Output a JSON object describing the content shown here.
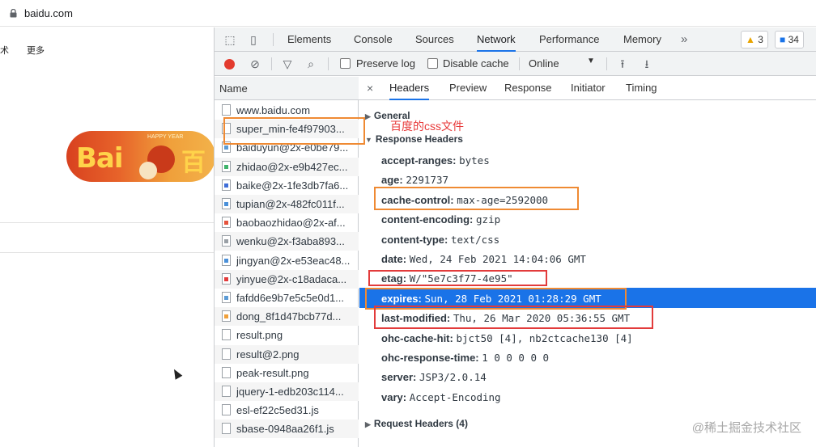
{
  "browser": {
    "url": "baidu.com"
  },
  "page": {
    "nav_left": "术",
    "nav_more": "更多",
    "doodle": {
      "logo_bai": "Bai",
      "logo_du": "百",
      "badge": "HAPPY  YEAR"
    }
  },
  "devtools": {
    "tabs": [
      "Elements",
      "Console",
      "Sources",
      "Network",
      "Performance",
      "Memory"
    ],
    "active_tab": "Network",
    "more_tabs": "»",
    "warnings": "3",
    "messages": "34",
    "toolbar": {
      "preserve_log": "Preserve log",
      "disable_cache": "Disable cache",
      "throttle": "Online",
      "caret": "▼"
    },
    "name_header": "Name",
    "requests": [
      {
        "name": "www.baidu.com",
        "mark": ""
      },
      {
        "name": "super_min-fe4f97903...",
        "mark": ""
      },
      {
        "name": "baiduyun@2x-e0be79...",
        "mark": "#5b9bd5"
      },
      {
        "name": "zhidao@2x-e9b427ec...",
        "mark": "#3fb36b"
      },
      {
        "name": "baike@2x-1fe3db7fa6...",
        "mark": "#3f6ed8"
      },
      {
        "name": "tupian@2x-482fc011f...",
        "mark": "#4a90d9"
      },
      {
        "name": "baobaozhidao@2x-af...",
        "mark": "#e5533d"
      },
      {
        "name": "wenku@2x-f3aba893...",
        "mark": "#9aa0a6"
      },
      {
        "name": "jingyan@2x-e53eac48...",
        "mark": "#4a90d9"
      },
      {
        "name": "yinyue@2x-c18adaca...",
        "mark": "#e23b3b"
      },
      {
        "name": "fafdd6e9b7e5c5e0d1...",
        "mark": "#5b9bd5"
      },
      {
        "name": "dong_8f1d47bcb77d...",
        "mark": "#f0a03b"
      },
      {
        "name": "result.png",
        "mark": ""
      },
      {
        "name": "result@2.png",
        "mark": ""
      },
      {
        "name": "peak-result.png",
        "mark": ""
      },
      {
        "name": "jquery-1-edb203c114...",
        "mark": ""
      },
      {
        "name": "esl-ef22c5ed31.js",
        "mark": ""
      },
      {
        "name": "sbase-0948aa26f1.js",
        "mark": ""
      }
    ],
    "detail_tabs": [
      "Headers",
      "Preview",
      "Response",
      "Initiator",
      "Timing"
    ],
    "active_detail_tab": "Headers",
    "close": "×",
    "general": "General",
    "response_headers_title": "Response Headers",
    "response_headers": [
      {
        "key": "accept-ranges:",
        "value": "bytes"
      },
      {
        "key": "age:",
        "value": "2291737"
      },
      {
        "key": "cache-control:",
        "value": "max-age=2592000"
      },
      {
        "key": "content-encoding:",
        "value": "gzip"
      },
      {
        "key": "content-type:",
        "value": "text/css"
      },
      {
        "key": "date:",
        "value": "Wed, 24 Feb 2021 14:04:06 GMT"
      },
      {
        "key": "etag:",
        "value": "W/\"5e7c3f77-4e95\""
      },
      {
        "key": "expires:",
        "value": "Sun, 28 Feb 2021 01:28:29 GMT"
      },
      {
        "key": "last-modified:",
        "value": "Thu, 26 Mar 2020 05:36:55 GMT"
      },
      {
        "key": "ohc-cache-hit:",
        "value": "bjct50 [4], nb2ctcache130 [4]"
      },
      {
        "key": "ohc-response-time:",
        "value": "1 0 0 0 0 0"
      },
      {
        "key": "server:",
        "value": "JSP3/2.0.14"
      },
      {
        "key": "vary:",
        "value": "Accept-Encoding"
      }
    ],
    "request_headers": "Request Headers (4)"
  },
  "annotation": {
    "label": "百度的css文件"
  },
  "watermark": "@稀土掘金技术社区",
  "colors": {
    "accent": "#1a73e8",
    "annot_orange": "#ef8a33",
    "annot_red": "#e23b3b"
  }
}
